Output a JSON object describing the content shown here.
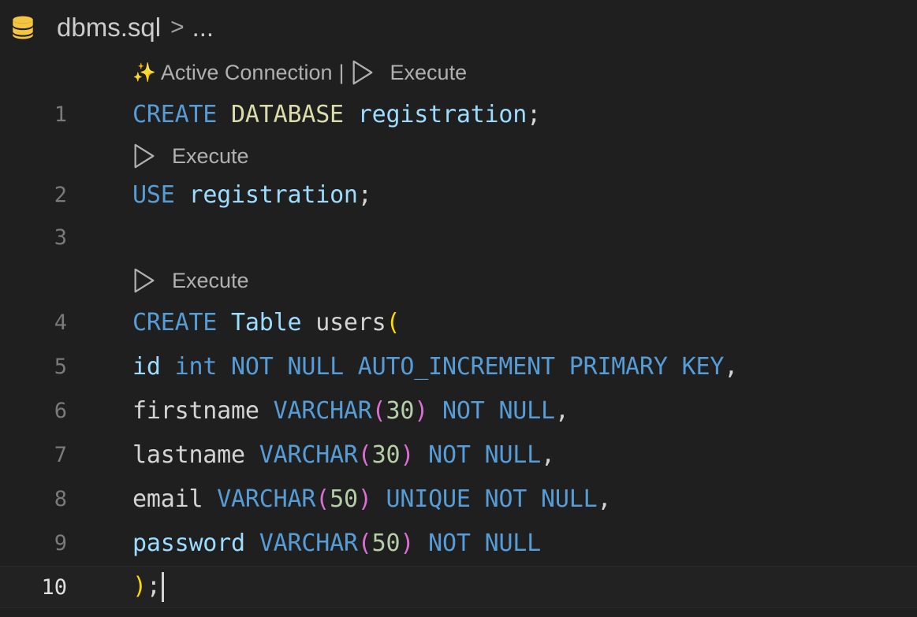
{
  "breadcrumb": {
    "file": "dbms.sql",
    "separator": ">",
    "tail": "..."
  },
  "codelens": {
    "active_connection": "Active Connection",
    "pipe": "|",
    "execute": "Execute"
  },
  "lines": [
    {
      "n": "1",
      "tokens": [
        [
          "kw",
          "CREATE "
        ],
        [
          "kwy",
          "DATABASE "
        ],
        [
          "id",
          "registration"
        ],
        [
          "punc",
          ";"
        ]
      ]
    },
    {
      "n": "2",
      "tokens": [
        [
          "kw",
          "USE "
        ],
        [
          "id",
          "registration"
        ],
        [
          "punc",
          ";"
        ]
      ]
    },
    {
      "n": "3",
      "tokens": []
    },
    {
      "n": "4",
      "tokens": [
        [
          "kw",
          "CREATE "
        ],
        [
          "id",
          "Table "
        ],
        [
          "idw",
          "users"
        ],
        [
          "par1",
          "("
        ]
      ]
    },
    {
      "n": "5",
      "tokens": [
        [
          "id",
          "id "
        ],
        [
          "kw",
          "int NOT NULL AUTO_INCREMENT PRIMARY KEY"
        ],
        [
          "punc",
          ","
        ]
      ]
    },
    {
      "n": "6",
      "tokens": [
        [
          "idw",
          "firstname "
        ],
        [
          "kw",
          "VARCHAR"
        ],
        [
          "par2",
          "("
        ],
        [
          "num",
          "30"
        ],
        [
          "par2",
          ")"
        ],
        [
          "kw",
          " NOT NULL"
        ],
        [
          "punc",
          ","
        ]
      ]
    },
    {
      "n": "7",
      "tokens": [
        [
          "idw",
          "lastname "
        ],
        [
          "kw",
          "VARCHAR"
        ],
        [
          "par2",
          "("
        ],
        [
          "num",
          "30"
        ],
        [
          "par2",
          ")"
        ],
        [
          "kw",
          " NOT NULL"
        ],
        [
          "punc",
          ","
        ]
      ]
    },
    {
      "n": "8",
      "tokens": [
        [
          "idw",
          "email "
        ],
        [
          "kw",
          "VARCHAR"
        ],
        [
          "par2",
          "("
        ],
        [
          "num",
          "50"
        ],
        [
          "par2",
          ")"
        ],
        [
          "kw",
          " UNIQUE NOT NULL"
        ],
        [
          "punc",
          ","
        ]
      ]
    },
    {
      "n": "9",
      "tokens": [
        [
          "id",
          "password "
        ],
        [
          "kw",
          "VARCHAR"
        ],
        [
          "par2",
          "("
        ],
        [
          "num",
          "50"
        ],
        [
          "par2",
          ")"
        ],
        [
          "kw",
          " NOT NULL"
        ]
      ]
    },
    {
      "n": "10",
      "tokens": [
        [
          "par1",
          ")"
        ],
        [
          "punc",
          ";"
        ]
      ]
    }
  ],
  "colors": {
    "background": "#1f1f1f",
    "keyword": "#569cd6",
    "identifier": "#9cdcfe",
    "number": "#b5cea8",
    "bracket_outer": "#ffd700",
    "bracket_inner": "#da70d6"
  }
}
